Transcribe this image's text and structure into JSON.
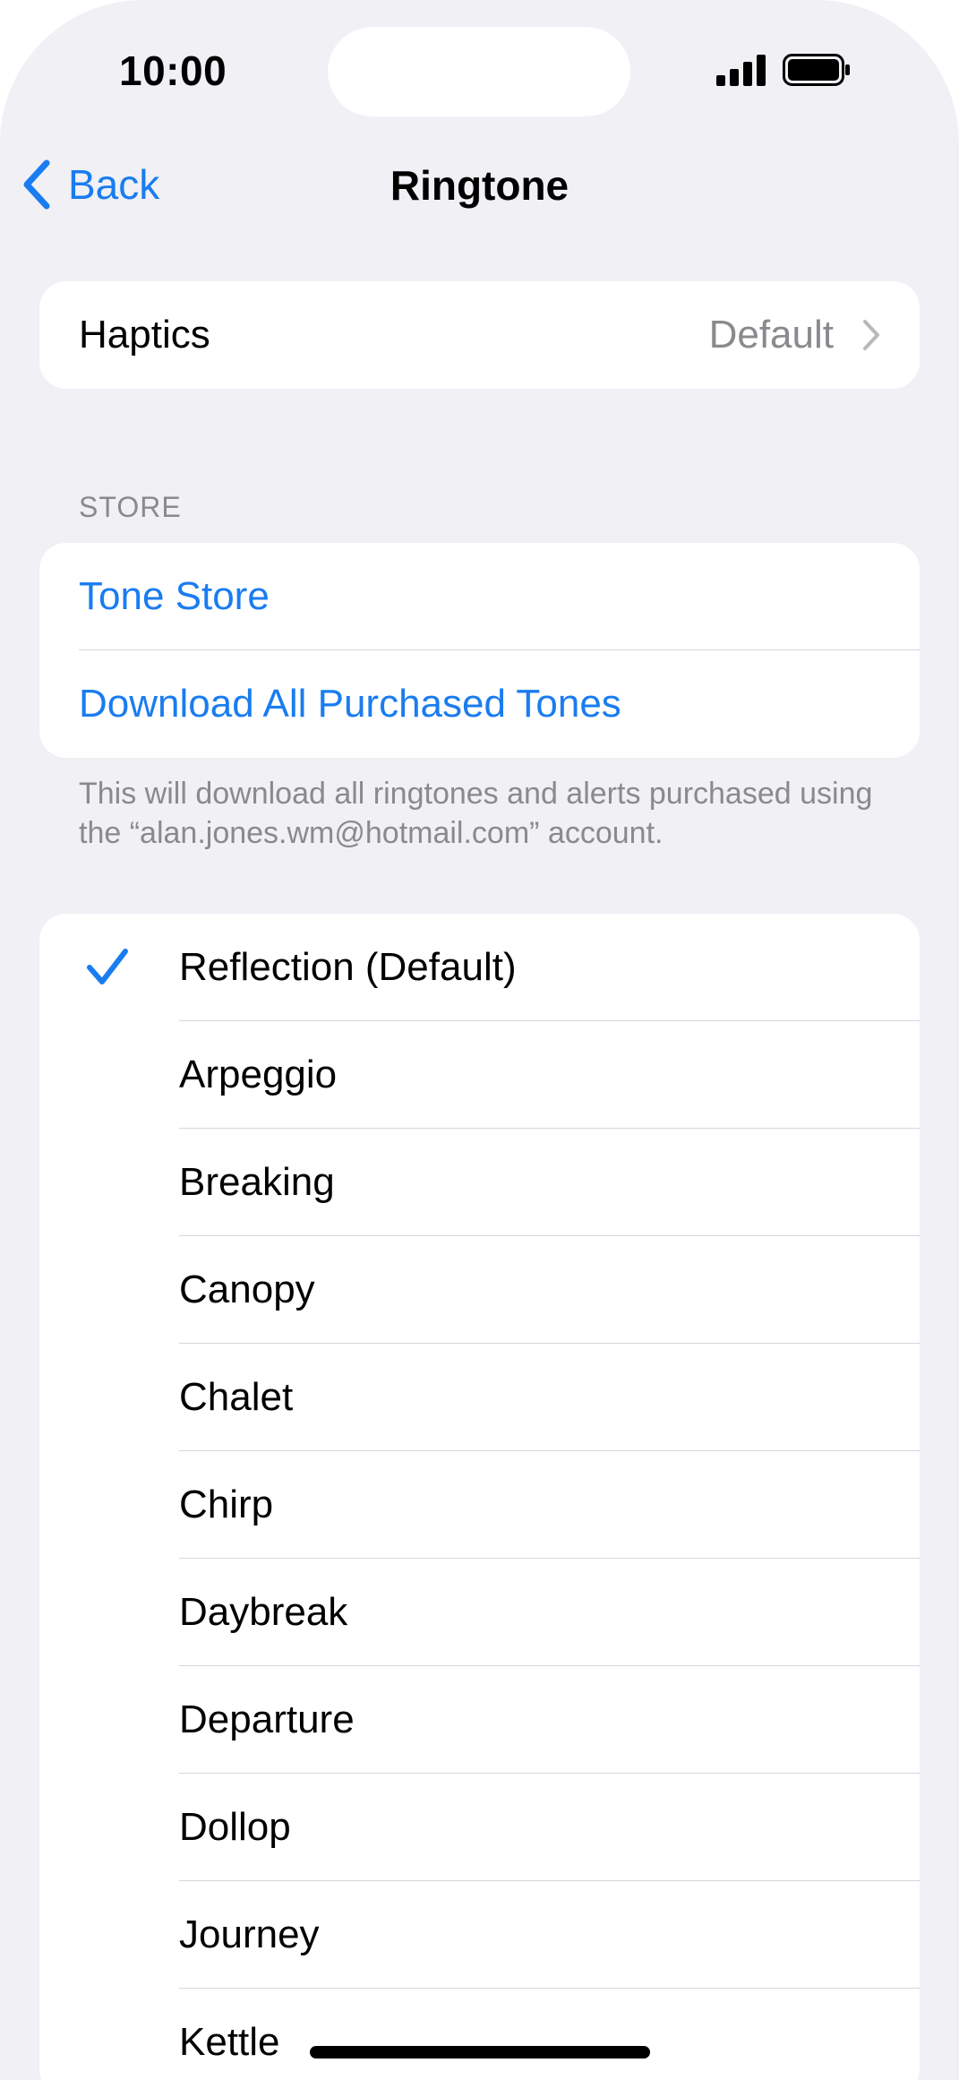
{
  "status_bar": {
    "time": "10:00",
    "signal_icon": "cellular-signal-icon",
    "battery_icon": "battery-full-icon"
  },
  "nav": {
    "back_label": "Back",
    "title": "Ringtone"
  },
  "haptics": {
    "label": "Haptics",
    "value": "Default"
  },
  "store": {
    "header": "STORE",
    "items": [
      {
        "label": "Tone Store"
      },
      {
        "label": "Download All Purchased Tones"
      }
    ],
    "footer": "This will download all ringtones and alerts purchased using the “alan.jones.wm@hotmail.com” account."
  },
  "tones": {
    "selected_index": 0,
    "items": [
      {
        "label": "Reflection (Default)"
      },
      {
        "label": "Arpeggio"
      },
      {
        "label": "Breaking"
      },
      {
        "label": "Canopy"
      },
      {
        "label": "Chalet"
      },
      {
        "label": "Chirp"
      },
      {
        "label": "Daybreak"
      },
      {
        "label": "Departure"
      },
      {
        "label": "Dollop"
      },
      {
        "label": "Journey"
      },
      {
        "label": "Kettle"
      }
    ]
  },
  "colors": {
    "accent": "#1a7cf0",
    "background": "#f0f0f5",
    "secondary_text": "#8a8a8e"
  }
}
